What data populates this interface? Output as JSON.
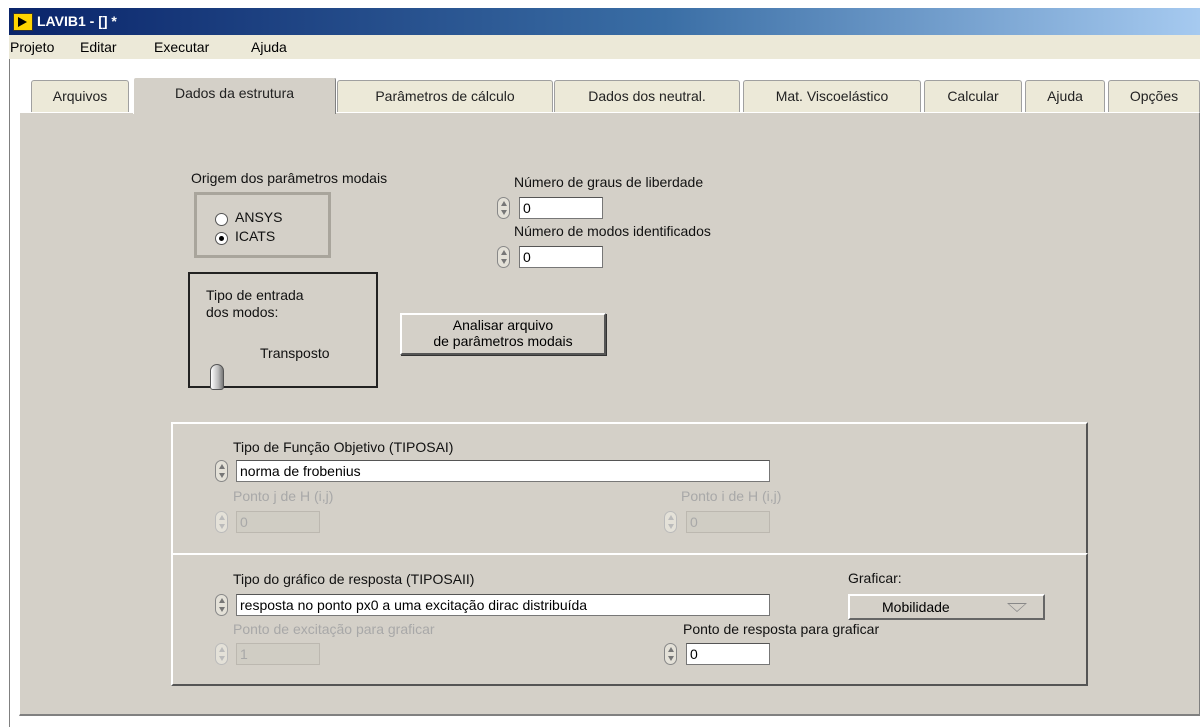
{
  "window": {
    "title": "LAVIB1 - [] *"
  },
  "menu": [
    "Projeto",
    "Editar",
    "Executar",
    "Ajuda"
  ],
  "tabs": [
    "Arquivos",
    "Dados da estrutura",
    "Parâmetros de cálculo",
    "Dados dos neutral.",
    "Mat. Viscoelástico",
    "Calcular",
    "Ajuda",
    "Opções"
  ],
  "active_tab": "Dados da estrutura",
  "modal_origin": {
    "label": "Origem dos parâmetros modais",
    "options": [
      "ANSYS",
      "ICATS"
    ],
    "selected": "ICATS"
  },
  "dof": {
    "label": "Número de graus de liberdade",
    "value": "0"
  },
  "modes": {
    "label": "Número de modos identificados",
    "value": "0"
  },
  "entry_type": {
    "label_line1": "Tipo de entrada",
    "label_line2": "dos modos:",
    "value": "Transposto"
  },
  "analyze_button": {
    "line1": "Analisar arquivo",
    "line2": "de parâmetros modais"
  },
  "objective": {
    "label": "Tipo de Função Objetivo (TIPOSAI)",
    "value": "norma de frobenius",
    "point_j_label": "Ponto j de H (i,j)",
    "point_j_value": "0",
    "point_i_label": "Ponto i de H (i,j)",
    "point_i_value": "0"
  },
  "response": {
    "label": "Tipo do gráfico de resposta (TIPOSAII)",
    "value": "resposta no ponto px0 a uma excitação dirac distribuída",
    "graficar_label": "Graficar:",
    "graficar_value": "Mobilidade",
    "excitation_label": "Ponto de excitação para graficar",
    "excitation_value": "1",
    "response_point_label": "Ponto de resposta para graficar",
    "response_point_value": "0"
  }
}
